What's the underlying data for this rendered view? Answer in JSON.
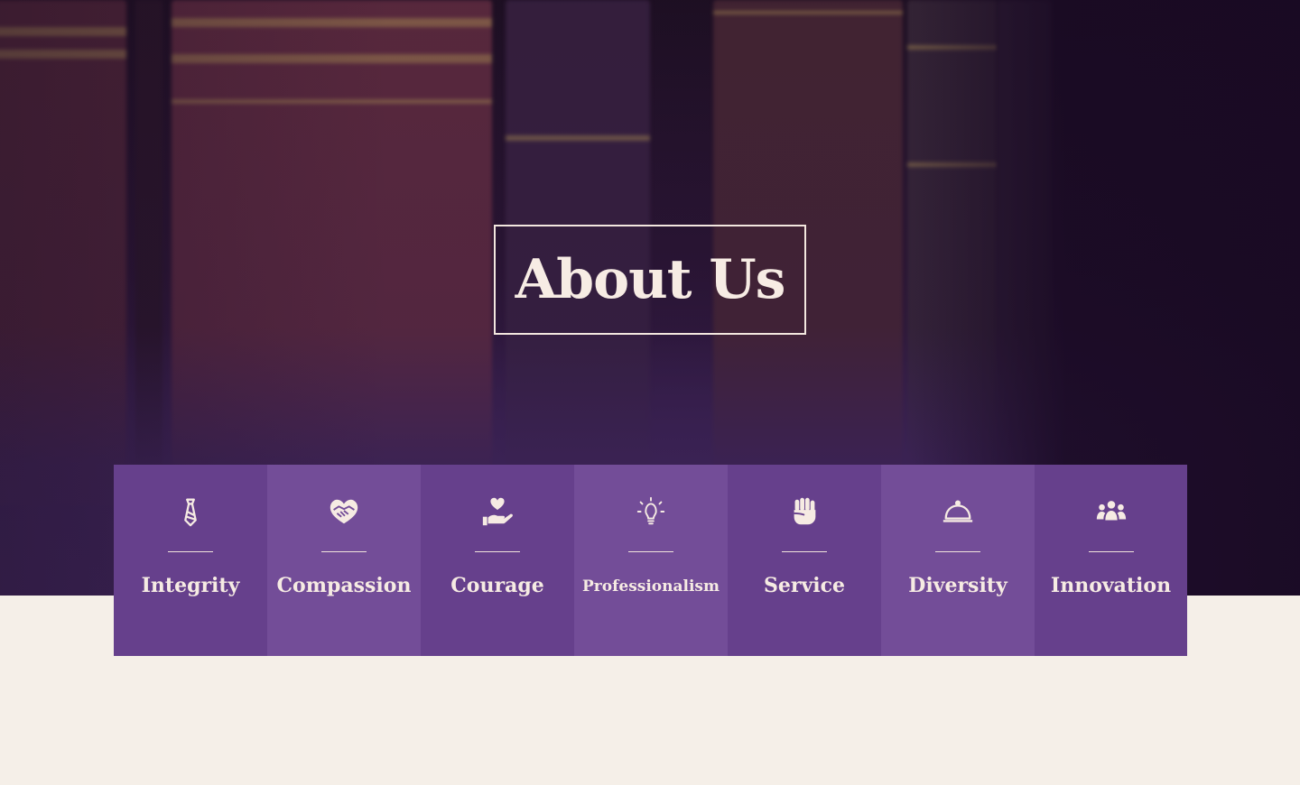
{
  "hero": {
    "title": "About Us"
  },
  "values": {
    "items": [
      {
        "label": "Integrity",
        "icon": "tie-icon"
      },
      {
        "label": "Compassion",
        "icon": "handshake-heart-icon"
      },
      {
        "label": "Courage",
        "icon": "hand-heart-icon"
      },
      {
        "label": "Professionalism",
        "icon": "lightbulb-icon"
      },
      {
        "label": "Service",
        "icon": "fist-icon"
      },
      {
        "label": "Diversity",
        "icon": "service-bell-icon"
      },
      {
        "label": "Innovation",
        "icon": "team-icon"
      }
    ]
  },
  "colors": {
    "card_dark": "#66408c",
    "card_light": "#734d98",
    "cream": "#f5efe8",
    "hero_dark": "#1d0f22"
  }
}
